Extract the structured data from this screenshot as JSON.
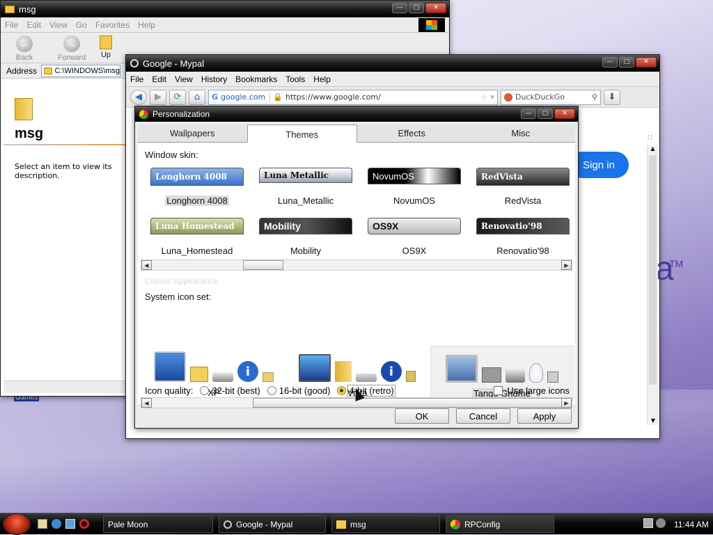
{
  "explorer": {
    "title": "msg",
    "menu": [
      "File",
      "Edit",
      "View",
      "Go",
      "Favorites",
      "Help"
    ],
    "toolbar": {
      "back": "Back",
      "forward": "Forward",
      "up": "Up"
    },
    "address_label": "Address",
    "address_value": "C:\\WINDOWS\\msg",
    "folder_title": "msg",
    "description": "Select an item to view its description.",
    "desktop_label": "Games"
  },
  "mypal": {
    "title": "Google - Mypal",
    "menu": [
      "File",
      "Edit",
      "View",
      "History",
      "Bookmarks",
      "Tools",
      "Help"
    ],
    "site_label": "google.com",
    "url": "https://www.google.com/",
    "search_placeholder": "DuckDuckGo",
    "sign_in": "Sign in",
    "bg_fragment": "a",
    "bg_tm": "TM"
  },
  "dialog": {
    "title": "Personalization",
    "tabs": [
      "Wallpapers",
      "Themes",
      "Effects",
      "Misc"
    ],
    "active_tab": "Themes",
    "window_skin_label": "Window skin:",
    "skins": [
      {
        "bar": "Longhorn 4008",
        "name": "Longhorn 4008"
      },
      {
        "bar": "Luna Metallic",
        "name": "Luna_Metallic"
      },
      {
        "bar": "NovumOS",
        "name": "NovumOS"
      },
      {
        "bar": "RedVista",
        "name": "RedVista"
      },
      {
        "bar": "Luna Homestead",
        "name": "Luna_Homestead"
      },
      {
        "bar": "Mobility",
        "name": "Mobility"
      },
      {
        "bar": "OS9X",
        "name": "OS9X"
      },
      {
        "bar": "Renovatio'98",
        "name": "Renovatio'98"
      }
    ],
    "classic_label": "Classic appearance",
    "icon_set_label": "System icon set:",
    "icon_sets": [
      "XP",
      "Vista",
      "Tango Gnome"
    ],
    "icon_quality_label": "Icon quality:",
    "quality_options": [
      "32-bit (best)",
      "16-bit (good)",
      "4-bit (retro)"
    ],
    "large_icons_label": "Use large icons",
    "buttons": {
      "ok": "OK",
      "cancel": "Cancel",
      "apply": "Apply"
    }
  },
  "taskbar": {
    "tasks": [
      "Pale Moon",
      "Google - Mypal",
      "msg",
      "RPConfig"
    ],
    "clock": "11:44 AM"
  },
  "colors": {
    "accent": "#1a73e8",
    "title_bg": "#1d1d1d"
  }
}
